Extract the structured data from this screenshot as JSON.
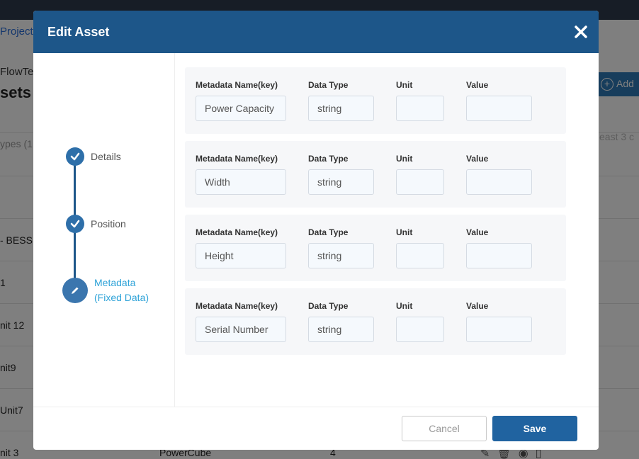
{
  "background": {
    "breadcrumb": "Project",
    "flow_text": "FlowTe",
    "page_title": "sets",
    "types_filter": "ypes (1",
    "hint_text": "east 3 c",
    "add_button_label": "Add",
    "rows": [
      "- BESS",
      "1",
      "nit 12",
      "nit9",
      "Unit7",
      "nit 3"
    ],
    "last_row_col2": "PowerCube",
    "last_row_col3": "4"
  },
  "modal": {
    "title": "Edit Asset",
    "close_icon": "close-icon",
    "steps": [
      {
        "label": "Details",
        "state": "completed",
        "icon": "check-icon"
      },
      {
        "label": "Position",
        "state": "completed",
        "icon": "check-icon"
      },
      {
        "label_line1": "Metadata",
        "label_line2": "(Fixed Data)",
        "state": "active",
        "icon": "pencil-icon"
      }
    ],
    "field_labels": {
      "name": "Metadata Name(key)",
      "type": "Data Type",
      "unit": "Unit",
      "value": "Value"
    },
    "metadata_rows": [
      {
        "name": "Power Capacity",
        "type": "string",
        "unit": "",
        "value": ""
      },
      {
        "name": "Width",
        "type": "string",
        "unit": "",
        "value": ""
      },
      {
        "name": "Height",
        "type": "string",
        "unit": "",
        "value": ""
      },
      {
        "name": "Serial Number",
        "type": "string",
        "unit": "",
        "value": ""
      }
    ],
    "cancel_label": "Cancel",
    "save_label": "Save"
  },
  "colors": {
    "header": "#1d5689",
    "accent_active_step": "#2fa3d8",
    "save_button": "#2063a0"
  }
}
